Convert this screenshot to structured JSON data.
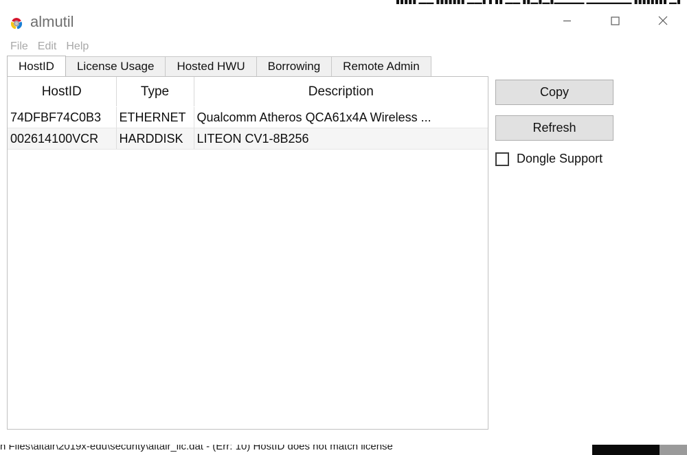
{
  "window": {
    "title": "almutil",
    "logo_icon": "almutil-logo-icon",
    "controls": {
      "minimize": "—",
      "maximize": "□",
      "close": "✕"
    }
  },
  "menubar": {
    "items": [
      {
        "label": "File"
      },
      {
        "label": "Edit"
      },
      {
        "label": "Help"
      }
    ]
  },
  "tabs": [
    {
      "label": "HostID",
      "active": true
    },
    {
      "label": "License Usage",
      "active": false
    },
    {
      "label": "Hosted HWU",
      "active": false
    },
    {
      "label": "Borrowing",
      "active": false
    },
    {
      "label": "Remote Admin",
      "active": false
    }
  ],
  "table": {
    "columns": [
      "HostID",
      "Type",
      "Description"
    ],
    "rows": [
      {
        "hostid": "74DFBF74C0B3",
        "type": "ETHERNET",
        "description": "Qualcomm Atheros QCA61x4A Wireless ..."
      },
      {
        "hostid": "002614100VCR",
        "type": "HARDDISK",
        "description": "LITEON CV1-8B256"
      }
    ]
  },
  "side_panel": {
    "copy_label": "Copy",
    "refresh_label": "Refresh",
    "dongle_label": "Dongle Support",
    "dongle_checked": false
  },
  "background": {
    "bottom_text": "n Files\\altair\\2019x-edu\\security\\altair_lic.dat - (Err: 10) HostID does not match license",
    "top_text": "▮▮▮▮▮ ▬▬ ▮▮▮▮▮▮▮ ▬▬▮ ▮ ▮▮ ▬▬ ▮▮▬▮▬▮▬▬▬▬ ▬▬▬▬▬▬ ▮▮▮▮▮▮▮▮ ▬▮"
  },
  "colors": {
    "logo_red": "#d5172e",
    "logo_yellow": "#f5c518",
    "logo_blue": "#1b7fd4",
    "logo_center": "#9b9b9b",
    "accent": "#0078d7",
    "button_face": "#e1e1e1",
    "tab_inactive": "#f0f0f0",
    "row_stripe": "#f5f5f5"
  }
}
